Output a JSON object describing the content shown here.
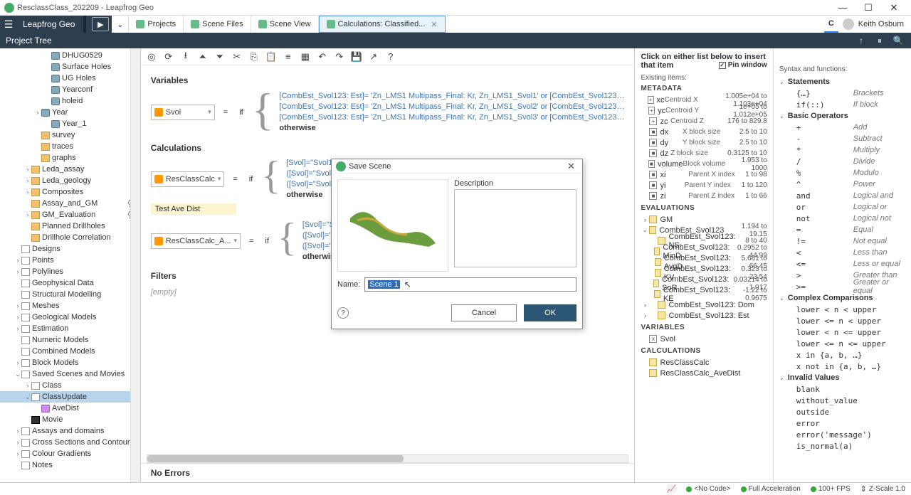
{
  "window": {
    "title": "ResclassClass_202209 - Leapfrog Geo"
  },
  "header": {
    "brand": "Leapfrog Geo",
    "tabs": [
      {
        "label": "Projects"
      },
      {
        "label": "Scene Files"
      },
      {
        "label": "Scene View"
      },
      {
        "label": "Calculations: Classified..."
      }
    ],
    "user": "Keith Osburn"
  },
  "panelHeader": {
    "title": "Project Tree"
  },
  "tree": {
    "items": [
      {
        "indent": 4,
        "icon": "cyl",
        "label": "DHUG0529"
      },
      {
        "indent": 4,
        "icon": "cyl",
        "label": "Surface Holes"
      },
      {
        "indent": 4,
        "icon": "cyl",
        "label": "UG Holes"
      },
      {
        "indent": 4,
        "icon": "cyl",
        "label": "Yearconf"
      },
      {
        "indent": 4,
        "icon": "cyl",
        "label": "holeid"
      },
      {
        "indent": 3,
        "expand": ">",
        "icon": "cyl",
        "label": "Year"
      },
      {
        "indent": 4,
        "icon": "cyl",
        "label": "Year_1"
      },
      {
        "indent": 3,
        "icon": "default",
        "label": "survey"
      },
      {
        "indent": 3,
        "icon": "default",
        "label": "traces"
      },
      {
        "indent": 3,
        "icon": "default",
        "label": "graphs"
      },
      {
        "indent": 2,
        "expand": ">",
        "icon": "default",
        "label": "Leda_assay"
      },
      {
        "indent": 2,
        "expand": ">",
        "icon": "default",
        "label": "Leda_geology"
      },
      {
        "indent": 2,
        "expand": ">",
        "icon": "default",
        "label": "Composites"
      },
      {
        "indent": 2,
        "icon": "default",
        "label": "Assay_and_GM",
        "tail": "💬"
      },
      {
        "indent": 2,
        "expand": ">",
        "icon": "default",
        "label": "GM_Evaluation",
        "tail": "💬"
      },
      {
        "indent": 2,
        "icon": "default",
        "label": "Planned Drillholes"
      },
      {
        "indent": 2,
        "icon": "default",
        "label": "Drillhole Correlation"
      },
      {
        "indent": 1,
        "icon": "fold",
        "label": "Designs"
      },
      {
        "indent": 1,
        "expand": ">",
        "icon": "fold",
        "label": "Points"
      },
      {
        "indent": 1,
        "expand": ">",
        "icon": "fold",
        "label": "Polylines"
      },
      {
        "indent": 1,
        "icon": "fold",
        "label": "Geophysical Data"
      },
      {
        "indent": 1,
        "icon": "fold",
        "label": "Structural Modelling"
      },
      {
        "indent": 1,
        "expand": ">",
        "icon": "fold",
        "label": "Meshes"
      },
      {
        "indent": 1,
        "expand": ">",
        "icon": "fold",
        "label": "Geological Models"
      },
      {
        "indent": 1,
        "expand": ">",
        "icon": "fold",
        "label": "Estimation"
      },
      {
        "indent": 1,
        "icon": "fold",
        "label": "Numeric Models"
      },
      {
        "indent": 1,
        "icon": "fold",
        "label": "Combined Models"
      },
      {
        "indent": 1,
        "expand": ">",
        "icon": "fold",
        "label": "Block Models"
      },
      {
        "indent": 1,
        "expand": "v",
        "icon": "fold",
        "label": "Saved Scenes and Movies"
      },
      {
        "indent": 2,
        "expand": ">",
        "icon": "fold",
        "label": "Class"
      },
      {
        "indent": 2,
        "expand": "v",
        "icon": "fold",
        "label": "ClassUpdate",
        "selected": true
      },
      {
        "indent": 3,
        "icon": "scene",
        "label": "AveDist"
      },
      {
        "indent": 2,
        "icon": "movie",
        "label": "Movie"
      },
      {
        "indent": 1,
        "expand": ">",
        "icon": "fold",
        "label": "Assays and domains"
      },
      {
        "indent": 1,
        "expand": ">",
        "icon": "fold",
        "label": "Cross Sections and Contours"
      },
      {
        "indent": 1,
        "expand": ">",
        "icon": "fold",
        "label": "Colour Gradients"
      },
      {
        "indent": 1,
        "icon": "fold",
        "label": "Notes"
      }
    ]
  },
  "editor": {
    "variables_label": "Variables",
    "calculations_label": "Calculations",
    "filters_label": "Filters",
    "noerrors_label": "No Errors",
    "empty_label": "[empty]",
    "combo1": "Svol",
    "combo2": "ResClassCalc",
    "combo3": "ResClassCalc_A...",
    "eq": "=",
    "if": "if",
    "testave": "Test Ave Dist",
    "var_lines": [
      "[CombEst_Svol123: Est]= 'Zn_LMS1 Multipass_Final: Kr, Zn_LMS1_Svol1' or [CombEst_Svol123…",
      "[CombEst_Svol123: Est]= 'Zn_LMS1 Multipass_Final: Kr, Zn_LMS1_Svol2' or [CombEst_Svol123…",
      "[CombEst_Svol123: Est]= 'Zn_LMS1 Multipass_Final: Kr, Zn_LMS1_Svol3' or [CombEst_Svol123…",
      "otherwise"
    ],
    "calc_lines": [
      "[Svol]=\"Svol1",
      "([Svol]=\"Svol1",
      "([Svol]=\"Svol1",
      "otherwise"
    ],
    "calc2_lines": [
      "[Svol]=\"Svol1",
      "([Svol]=\"Svol1",
      "([Svol]=\"Svol1",
      "otherwise"
    ]
  },
  "right": {
    "title": "Click on either list below to insert that item",
    "pin": "Pin window",
    "left_title": "Existing items:",
    "right_title": "Syntax and functions:",
    "metadata_label": "METADATA",
    "metadata": [
      {
        "icon": "+",
        "name": "xc",
        "desc": "Centroid X",
        "val": "1.005e+04 to 1.103e+04"
      },
      {
        "icon": "+",
        "name": "yc",
        "desc": "Centroid Y",
        "val": "1e+05 to 1.012e+05"
      },
      {
        "icon": "+",
        "name": "zc",
        "desc": "Centroid Z",
        "val": "176 to 829.8"
      },
      {
        "icon": "■",
        "name": "dx",
        "desc": "X block size",
        "val": "2.5 to 10"
      },
      {
        "icon": "■",
        "name": "dy",
        "desc": "Y block size",
        "val": "2.5 to 10"
      },
      {
        "icon": "■",
        "name": "dz",
        "desc": "Z block size",
        "val": "0.3125 to 10"
      },
      {
        "icon": "■",
        "name": "volume",
        "desc": "Block volume",
        "val": "1.953 to 1000"
      },
      {
        "icon": "■",
        "name": "xi",
        "desc": "Parent X index",
        "val": "1 to 98"
      },
      {
        "icon": "■",
        "name": "yi",
        "desc": "Parent Y index",
        "val": "1 to 120"
      },
      {
        "icon": "■",
        "name": "zi",
        "desc": "Parent Z index",
        "val": "1 to 66"
      }
    ],
    "evaluations_label": "EVALUATIONS",
    "evaluations": [
      {
        "expand": ">",
        "name": "GM",
        "val": ""
      },
      {
        "expand": "v",
        "name": "CombEst_Svol123",
        "val": "1.194 to 19.15"
      },
      {
        "indent": 1,
        "name": "CombEst_Svol123: NS",
        "val": "8 to 40"
      },
      {
        "indent": 1,
        "name": "CombEst_Svol123: MinD",
        "val": "0.2952 to 44.99"
      },
      {
        "indent": 1,
        "name": "CombEst_Svol123: AvgD",
        "val": "5.681 to 66.45"
      },
      {
        "indent": 1,
        "name": "CombEst_Svol123: KV",
        "val": "0.323 to 23.54"
      },
      {
        "indent": 1,
        "name": "CombEst_Svol123: SoR",
        "val": "0.03214 to 1.017"
      },
      {
        "indent": 1,
        "name": "CombEst_Svol123: KE",
        "val": "-1.22 to 0.9675"
      },
      {
        "expand": ">",
        "indent": 1,
        "name": "CombEst_Svol123: Dom",
        "val": ""
      },
      {
        "expand": ">",
        "indent": 1,
        "name": "CombEst_Svol123: Est",
        "val": ""
      }
    ],
    "variables_label": "VARIABLES",
    "variables": [
      {
        "name": "Svol"
      }
    ],
    "calculations_label": "CALCULATIONS",
    "calculations": [
      {
        "name": "ResClassCalc"
      },
      {
        "name": "ResClassCalc_AveDist"
      }
    ],
    "syntax_groups": [
      {
        "name": "Statements",
        "items": [
          {
            "code": "{…}",
            "desc": "Brackets"
          },
          {
            "code": "if(::)",
            "desc": "If block"
          }
        ]
      },
      {
        "name": "Basic Operators",
        "items": [
          {
            "code": "+",
            "desc": "Add"
          },
          {
            "code": "-",
            "desc": "Subtract"
          },
          {
            "code": "*",
            "desc": "Multiply"
          },
          {
            "code": "/",
            "desc": "Divide"
          },
          {
            "code": "%",
            "desc": "Modulo"
          },
          {
            "code": "^",
            "desc": "Power"
          },
          {
            "code": "and",
            "desc": "Logical and"
          },
          {
            "code": "or",
            "desc": "Logical or"
          },
          {
            "code": "not",
            "desc": "Logical not"
          },
          {
            "code": "=",
            "desc": "Equal"
          },
          {
            "code": "!=",
            "desc": "Not equal"
          },
          {
            "code": "<",
            "desc": "Less than"
          },
          {
            "code": "<=",
            "desc": "Less or equal"
          },
          {
            "code": ">",
            "desc": "Greater than"
          },
          {
            "code": ">=",
            "desc": "Greater or equal"
          }
        ]
      },
      {
        "name": "Complex Comparisons",
        "items": [
          {
            "code": "lower < n < upper",
            "desc": ""
          },
          {
            "code": "lower <= n < upper",
            "desc": ""
          },
          {
            "code": "lower < n <= upper",
            "desc": ""
          },
          {
            "code": "lower <= n <= upper",
            "desc": ""
          },
          {
            "code": "x in {a, b, …}",
            "desc": ""
          },
          {
            "code": "x not in {a, b, …}",
            "desc": ""
          }
        ]
      },
      {
        "name": "Invalid Values",
        "items": [
          {
            "code": "blank",
            "desc": ""
          },
          {
            "code": "without_value",
            "desc": ""
          },
          {
            "code": "outside",
            "desc": ""
          },
          {
            "code": "error",
            "desc": ""
          },
          {
            "code": "error('message')",
            "desc": ""
          },
          {
            "code": "is_normal(a)",
            "desc": ""
          }
        ]
      }
    ]
  },
  "dialog": {
    "title": "Save Scene",
    "desc_label": "Description",
    "name_label": "Name:",
    "name_value": "Scene 1",
    "cancel": "Cancel",
    "ok": "OK"
  },
  "status": {
    "nocode": "<No Code>",
    "fullaccel": "Full Acceleration",
    "fps": "100+ FPS",
    "zscale": "Z-Scale 1.0"
  }
}
